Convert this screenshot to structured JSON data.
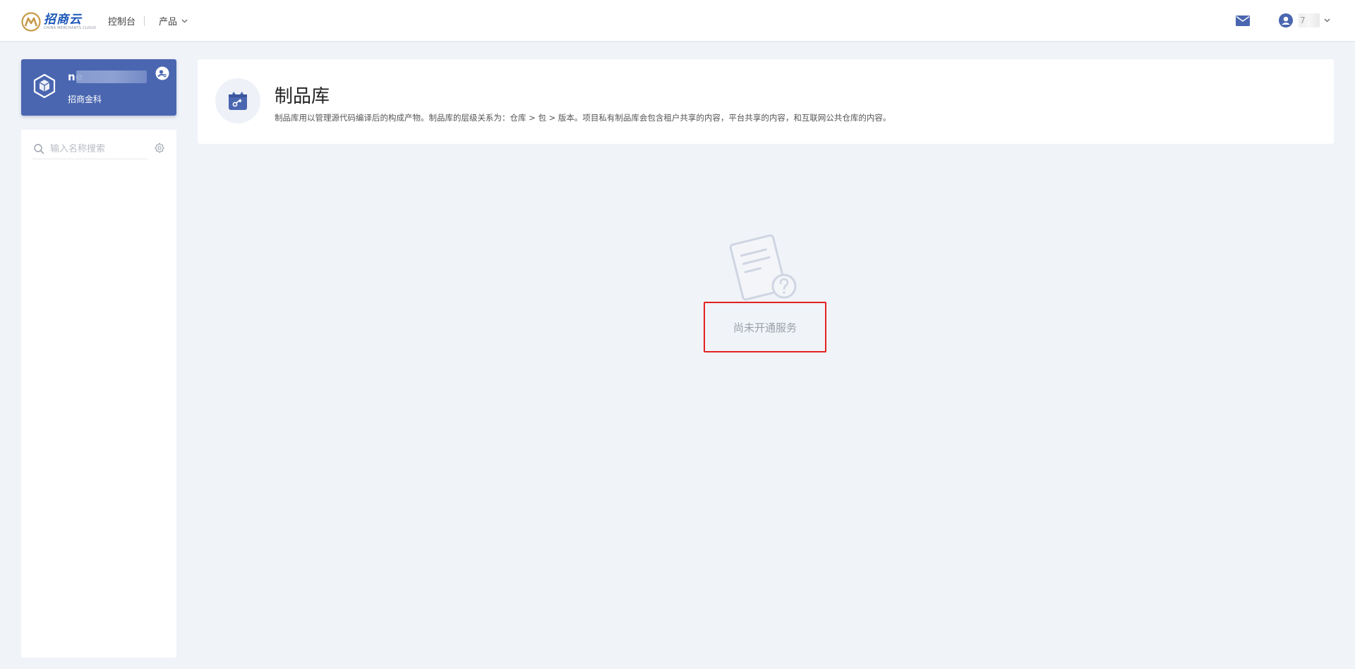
{
  "header": {
    "logo_cn": "招商云",
    "logo_en": "CHINA MERCHANTS CLOUD",
    "nav_console": "控制台",
    "nav_products": "产品",
    "user_name": "7"
  },
  "project": {
    "name": "ne",
    "subtitle": "招商金科"
  },
  "sidebar": {
    "search_placeholder": "输入名称搜索"
  },
  "page": {
    "title": "制品库",
    "description": "制品库用以管理源代码编译后的构成产物。制品库的层级关系为：仓库 > 包 > 版本。项目私有制品库会包含租户共享的内容，平台共享的内容，和互联网公共仓库的内容。"
  },
  "empty_state": {
    "message": "尚未开通服务"
  },
  "colors": {
    "primary": "#4a66b0",
    "background": "#f0f3f8",
    "highlight_border": "#e2221f"
  }
}
